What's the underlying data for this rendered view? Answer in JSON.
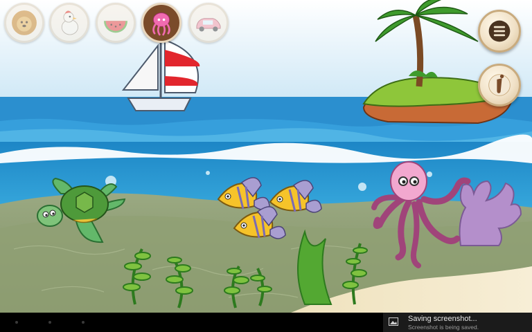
{
  "categories": [
    {
      "id": "animals",
      "icon": "lion-icon",
      "state": "dim"
    },
    {
      "id": "farm",
      "icon": "rooster-icon",
      "state": "dim"
    },
    {
      "id": "fruits",
      "icon": "watermelon-icon",
      "state": "dim"
    },
    {
      "id": "sea",
      "icon": "jellyfish-icon",
      "state": "active"
    },
    {
      "id": "vehicles",
      "icon": "car-icon",
      "state": "dim"
    }
  ],
  "side_buttons": [
    {
      "id": "menu",
      "icon": "hamburger-menu-icon"
    },
    {
      "id": "info",
      "icon": "info-icon"
    }
  ],
  "scene_objects": [
    "sailboat",
    "palm-island",
    "sea-turtle",
    "yellow-fish-1",
    "yellow-fish-2",
    "yellow-fish-3",
    "pink-octopus",
    "purple-coral",
    "green-seaweed"
  ],
  "colors": {
    "sky": "#cde6f5",
    "sea": "#2a9bd3",
    "seabed": "#8c9a72",
    "sand": "#f1e6c4",
    "active_category": "#7a4b2a"
  },
  "notification": {
    "title": "Saving screenshot...",
    "subtitle": "Screenshot is being saved."
  }
}
